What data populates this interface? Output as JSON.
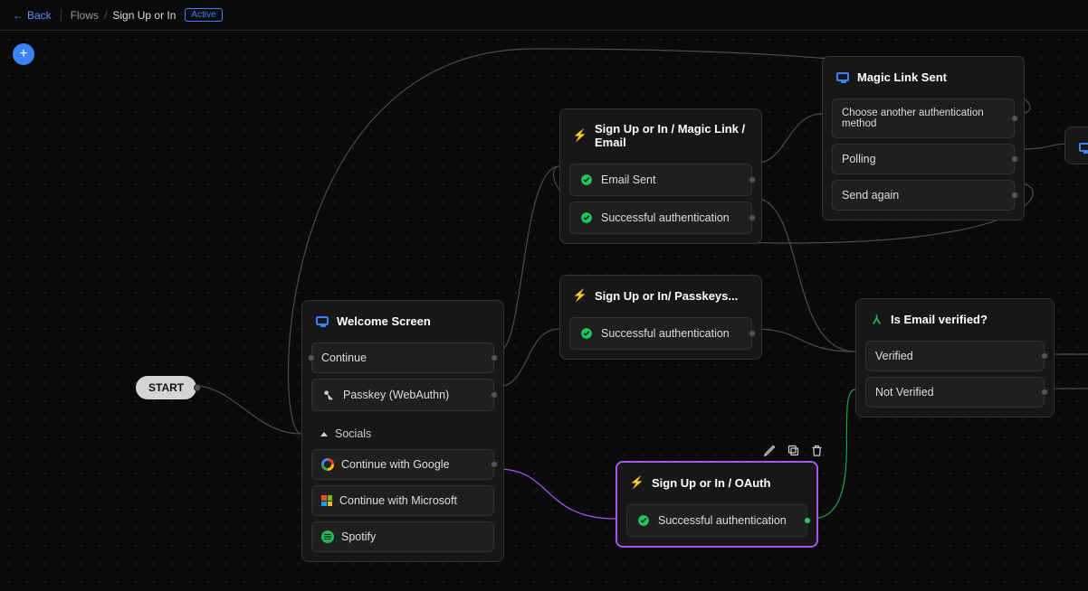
{
  "topbar": {
    "back": "Back",
    "crumb1": "Flows",
    "crumb2": "Sign Up or In",
    "status": "Active"
  },
  "fab_label": "+",
  "start_label": "START",
  "nodes": {
    "welcome": {
      "title": "Welcome Screen",
      "rows": {
        "continue": "Continue",
        "passkey": "Passkey (WebAuthn)",
        "socials_header": "Socials",
        "google": "Continue with Google",
        "microsoft": "Continue with Microsoft",
        "spotify": "Spotify"
      }
    },
    "magiclink": {
      "title": "Sign Up or In / Magic Link / Email",
      "rows": {
        "emailsent": "Email Sent",
        "success": "Successful authentication"
      }
    },
    "passkeys": {
      "title": "Sign Up or In/ Passkeys...",
      "rows": {
        "success": "Successful authentication"
      }
    },
    "oauth": {
      "title": "Sign Up or In / OAuth",
      "rows": {
        "success": "Successful authentication"
      }
    },
    "linksent": {
      "title": "Magic Link Sent",
      "rows": {
        "choose": "Choose another authentication method",
        "polling": "Polling",
        "sendagain": "Send again"
      }
    },
    "emailverified": {
      "title": "Is Email verified?",
      "rows": {
        "verified": "Verified",
        "notverified": "Not Verified"
      }
    }
  },
  "toolbar": {
    "edit": "edit",
    "copy": "copy",
    "delete": "delete"
  }
}
